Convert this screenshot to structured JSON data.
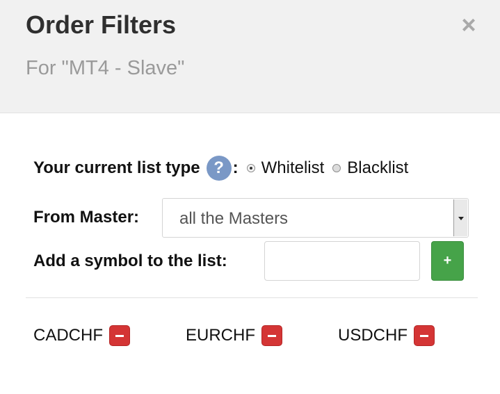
{
  "header": {
    "title": "Order Filters",
    "subtitle": "For \"MT4 - Slave\"",
    "close_label": "×"
  },
  "list_type": {
    "label": "Your current list type",
    "help_label": "?",
    "colon": ":",
    "options": [
      {
        "label": "Whitelist",
        "checked": true
      },
      {
        "label": "Blacklist",
        "checked": false
      }
    ]
  },
  "master": {
    "label": "From Master:",
    "selected": "all the Masters"
  },
  "add_symbol": {
    "label": "Add a symbol to the list:",
    "value": "",
    "button_label": "+"
  },
  "symbols": [
    "CADCHF",
    "EURCHF",
    "USDCHF"
  ],
  "colors": {
    "header_bg": "#f1f1f1",
    "help_icon": "#7a98c6",
    "add_button": "#46a349",
    "remove_button": "#d43535"
  }
}
